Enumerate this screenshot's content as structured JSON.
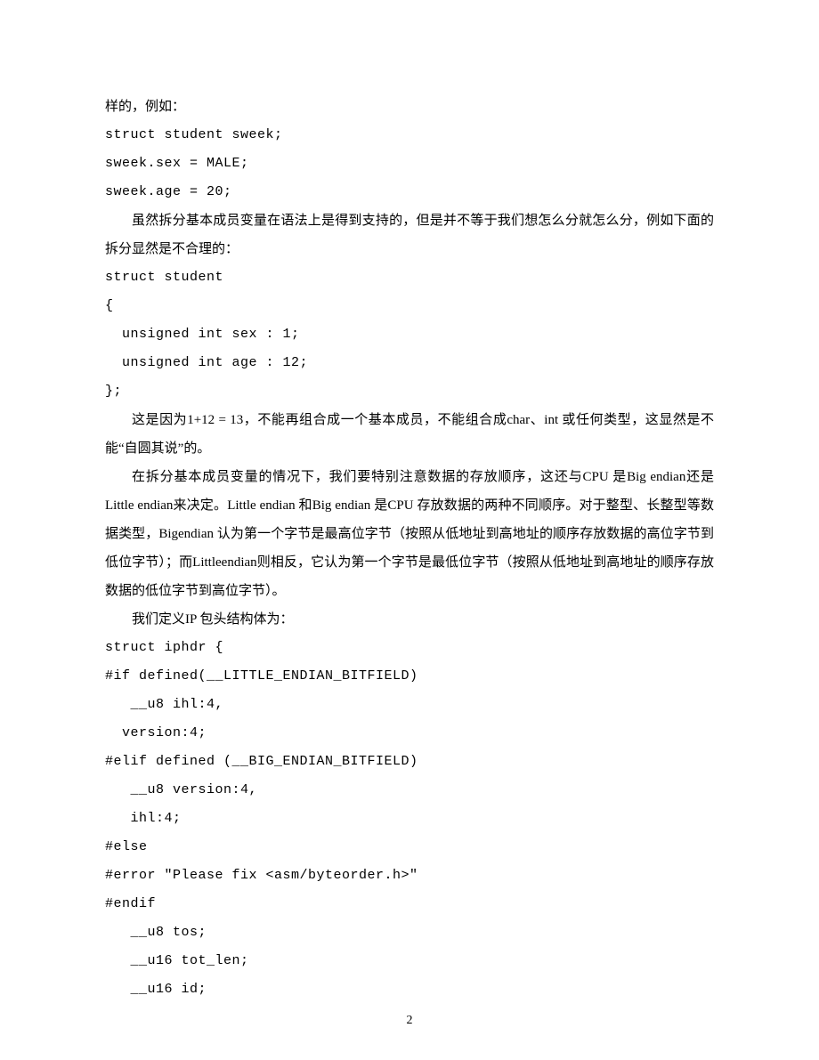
{
  "lines": {
    "l1": "样的，例如：",
    "l2": "struct student sweek;",
    "l3": "sweek.sex = MALE;",
    "l4": "sweek.age = 20;",
    "p1": "虽然拆分基本成员变量在语法上是得到支持的，但是并不等于我们想怎么分就怎么分，例如下面的拆分显然是不合理的：",
    "l5": "struct student",
    "l6": "{",
    "l7": "  unsigned int sex : 1;",
    "l8": "  unsigned int age : 12;",
    "l9": "};",
    "p2": "这是因为1+12 = 13，不能再组合成一个基本成员，不能组合成char、int 或任何类型，这显然是不能“自圆其说”的。",
    "p3": "在拆分基本成员变量的情况下，我们要特别注意数据的存放顺序，这还与CPU 是Big endian还是Little endian来决定。Little endian 和Big endian 是CPU 存放数据的两种不同顺序。对于整型、长整型等数据类型，Bigendian 认为第一个字节是最高位字节（按照从低地址到高地址的顺序存放数据的高位字节到低位字节）；而Littleendian则相反，它认为第一个字节是最低位字节（按照从低地址到高地址的顺序存放数据的低位字节到高位字节）。",
    "p4": "我们定义IP 包头结构体为：",
    "l10": "struct iphdr {",
    "l11": "#if defined(__LITTLE_ENDIAN_BITFIELD)",
    "l12": "   __u8 ihl:4,",
    "l13": "  version:4;",
    "l14": "#elif defined (__BIG_ENDIAN_BITFIELD)",
    "l15": "   __u8 version:4,",
    "l16": "   ihl:4;",
    "l17": "#else",
    "l18": "#error \"Please fix <asm/byteorder.h>\"",
    "l19": "#endif",
    "l20": "   __u8 tos;",
    "l21": "   __u16 tot_len;",
    "l22": "   __u16 id;"
  },
  "pageNumber": "2"
}
